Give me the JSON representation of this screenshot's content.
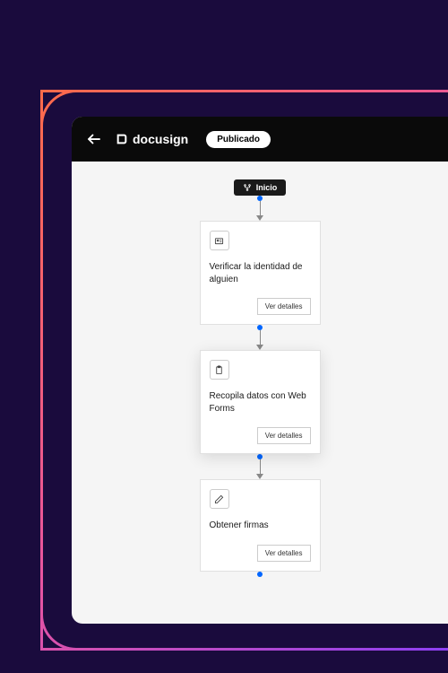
{
  "header": {
    "brand": "docusign",
    "status": "Publicado"
  },
  "flow": {
    "start_label": "Inicio",
    "steps": [
      {
        "title": "Verificar la identidad de alguien",
        "details_label": "Ver detalles",
        "icon": "id-verify"
      },
      {
        "title": "Recopila datos con Web Forms",
        "details_label": "Ver detalles",
        "icon": "clipboard"
      },
      {
        "title": "Obtener firmas",
        "details_label": "Ver detalles",
        "icon": "pen"
      }
    ]
  }
}
